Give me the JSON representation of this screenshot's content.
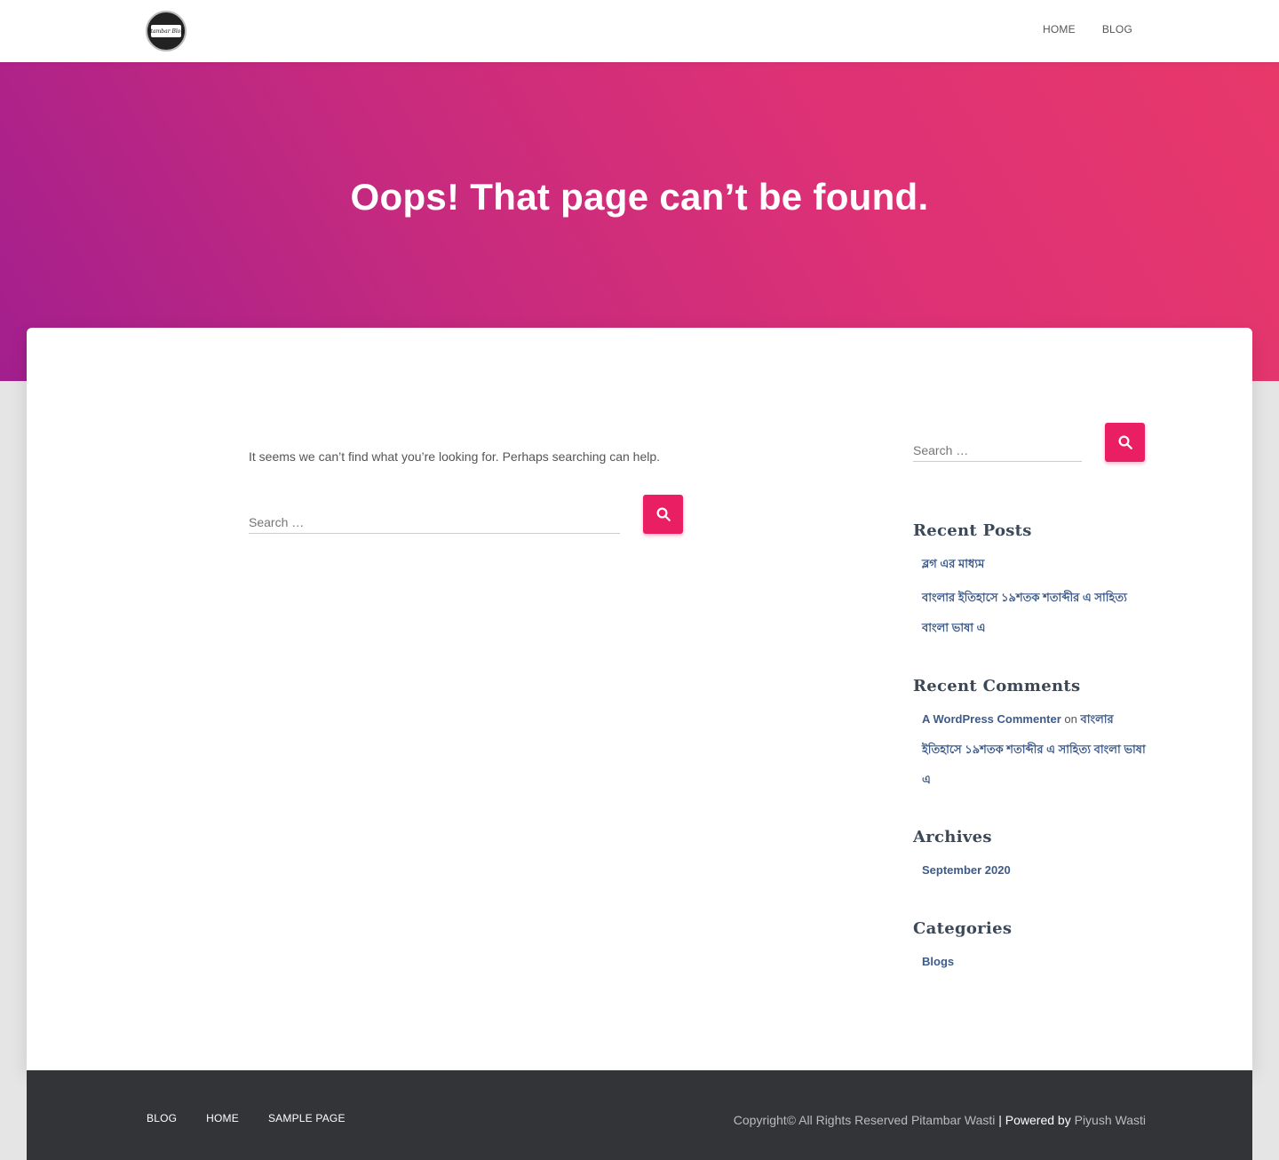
{
  "header": {
    "logo_text": "Pitambar Blogs",
    "nav": [
      "HOME",
      "BLOG"
    ]
  },
  "hero": {
    "title": "Oops! That page can’t be found."
  },
  "main": {
    "intro": "It seems we can’t find what you’re looking for. Perhaps searching can help.",
    "search_placeholder": "Search …"
  },
  "sidebar": {
    "search_placeholder": "Search …",
    "recent_posts": {
      "title": "Recent Posts",
      "items": [
        "ব্লগ এর মাধ্যম",
        "বাংলার ইতিহাসে ১৯শতক শতাব্দীর এ সাহিত্য বাংলা ভাষা এ"
      ]
    },
    "recent_comments": {
      "title": "Recent Comments",
      "author": "A WordPress Commenter",
      "on": "on",
      "post": "বাংলার ইতিহাসে ১৯শতক শতাব্দীর এ সাহিত্য বাংলা ভাষা এ"
    },
    "archives": {
      "title": "Archives",
      "items": [
        "September 2020"
      ]
    },
    "categories": {
      "title": "Categories",
      "items": [
        "Blogs"
      ]
    }
  },
  "footer": {
    "links": [
      "BLOG",
      "HOME",
      "SAMPLE PAGE"
    ],
    "copyright": "Copyright© All Rights Reserved Pitambar Wasti",
    "separator": " | Powered by ",
    "powered_by": "Piyush Wasti"
  },
  "colors": {
    "accent": "#e91e63",
    "hero_start": "#a31f8e",
    "hero_end": "#e8386a",
    "link": "#3c5a8a",
    "footer_bg": "#323437"
  }
}
